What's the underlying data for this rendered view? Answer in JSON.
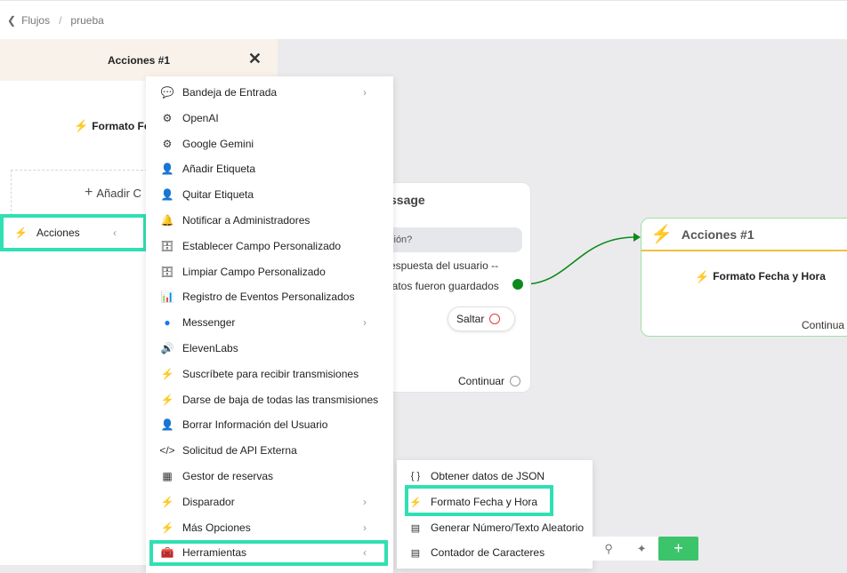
{
  "breadcrumb": {
    "root": "Flujos",
    "current": "prueba"
  },
  "panel": {
    "title": "Acciones #1",
    "action_label": "Formato Fe",
    "add_label": "Añadir C",
    "acciones_label": "Acciones"
  },
  "menu": {
    "items": [
      {
        "icon": "inbox-icon",
        "glyph": "💬",
        "label": "Bandeja de Entrada",
        "has_sub": true
      },
      {
        "icon": "openai-icon",
        "glyph": "⚙",
        "label": "OpenAI",
        "has_sub": false
      },
      {
        "icon": "gemini-icon",
        "glyph": "⚙",
        "label": "Google Gemini",
        "has_sub": false
      },
      {
        "icon": "add-tag-icon",
        "glyph": "👤",
        "label": "Añadir Etiqueta",
        "has_sub": false
      },
      {
        "icon": "remove-tag-icon",
        "glyph": "👤",
        "label": "Quitar Etiqueta",
        "has_sub": false
      },
      {
        "icon": "bell-icon",
        "glyph": "🔔",
        "label": "Notificar a Administradores",
        "has_sub": false
      },
      {
        "icon": "database-icon",
        "glyph": "🗄",
        "label": "Establecer Campo Personalizado",
        "has_sub": false
      },
      {
        "icon": "database-icon",
        "glyph": "🗄",
        "label": "Limpiar Campo Personalizado",
        "has_sub": false
      },
      {
        "icon": "chart-icon",
        "glyph": "📊",
        "label": "Registro de Eventos Personalizados",
        "has_sub": false
      },
      {
        "icon": "messenger-icon",
        "glyph": "●",
        "label": "Messenger",
        "has_sub": true
      },
      {
        "icon": "speaker-icon",
        "glyph": "🔊",
        "label": "ElevenLabs",
        "has_sub": false
      },
      {
        "icon": "bolt-icon",
        "glyph": "⚡",
        "label": "Suscríbete para recibir transmisiones",
        "has_sub": false
      },
      {
        "icon": "bolt-icon",
        "glyph": "⚡",
        "label": "Darse de baja de todas las transmisiones",
        "has_sub": false
      },
      {
        "icon": "user-remove-icon",
        "glyph": "👤",
        "label": "Borrar Información del Usuario",
        "has_sub": false
      },
      {
        "icon": "code-icon",
        "glyph": "</>",
        "label": "Solicitud de API Externa",
        "has_sub": false
      },
      {
        "icon": "calendar-icon",
        "glyph": "▦",
        "label": "Gestor de reservas",
        "has_sub": false
      },
      {
        "icon": "bolt-icon",
        "glyph": "⚡",
        "label": "Disparador",
        "has_sub": true
      },
      {
        "icon": "bolt-icon",
        "glyph": "⚡",
        "label": "Más Opciones",
        "has_sub": true
      },
      {
        "icon": "toolbox-icon",
        "glyph": "🧰",
        "label": "Herramientas",
        "has_sub": true
      }
    ]
  },
  "submenu": {
    "items": [
      {
        "icon": "braces-icon",
        "glyph": "{ }",
        "label": "Obtener datos de JSON"
      },
      {
        "icon": "bolt-icon",
        "glyph": "⚡",
        "label": "Formato Fecha y Hora"
      },
      {
        "icon": "doc-icon",
        "glyph": "▤",
        "label": "Generar Número/Texto Aleatorio"
      },
      {
        "icon": "doc-icon",
        "glyph": "▤",
        "label": "Contador de Caracteres"
      }
    ]
  },
  "message_node": {
    "title": "ssage",
    "bubble": "ción?",
    "line1": "espuesta del usuario --",
    "line2": "latos fueron guardados",
    "skip_label": "Saltar",
    "continue_label": "Continuar"
  },
  "actions_node": {
    "title": "Acciones #1",
    "action_label": "Formato Fecha y Hora",
    "continue_label": "Continua"
  },
  "toolbar": {
    "add_glyph": "+"
  },
  "colors": {
    "highlight": "#2fe0b2",
    "accent_green": "#3cc46a",
    "bolt": "#f0b400",
    "connection": "#0c8a1b"
  }
}
